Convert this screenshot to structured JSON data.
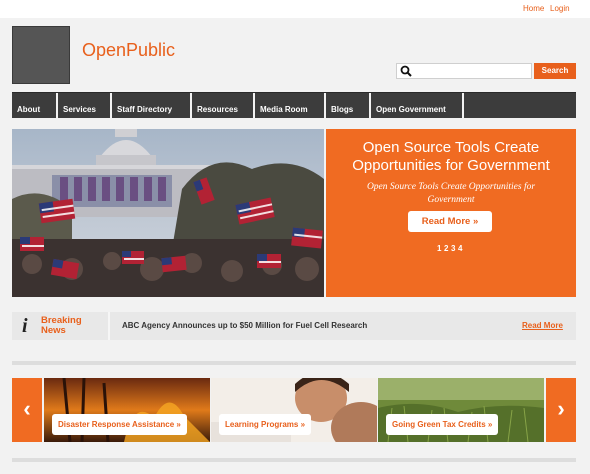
{
  "topbar": {
    "home": "Home",
    "login": "Login"
  },
  "header": {
    "site_name": "OpenPublic",
    "search_placeholder": "",
    "search_button": "Search"
  },
  "nav": [
    "About",
    "Services",
    "Staff Directory",
    "Resources",
    "Media Room",
    "Blogs",
    "Open Government"
  ],
  "hero": {
    "title": "Open Source Tools Create Opportunities for Government",
    "subtitle": "Open Source Tools Create Opportunities for Government",
    "read_more": "Read More »",
    "pages": [
      "1",
      "2",
      "3",
      "4"
    ]
  },
  "news": {
    "label_line1": "Breaking",
    "label_line2": "News",
    "headline": "ABC Agency Announces up to $50 Million for Fuel Cell Research",
    "read_more": "Read More"
  },
  "carousel": {
    "prev": "‹",
    "next": "›",
    "slides": [
      {
        "caption": "Disaster Response Assistance »"
      },
      {
        "caption": "Learning Programs »"
      },
      {
        "caption": "Going Green Tax Credits »"
      }
    ]
  },
  "colors": {
    "accent": "#e8601c",
    "panel": "#f06b22",
    "nav": "#3c3c3c"
  }
}
